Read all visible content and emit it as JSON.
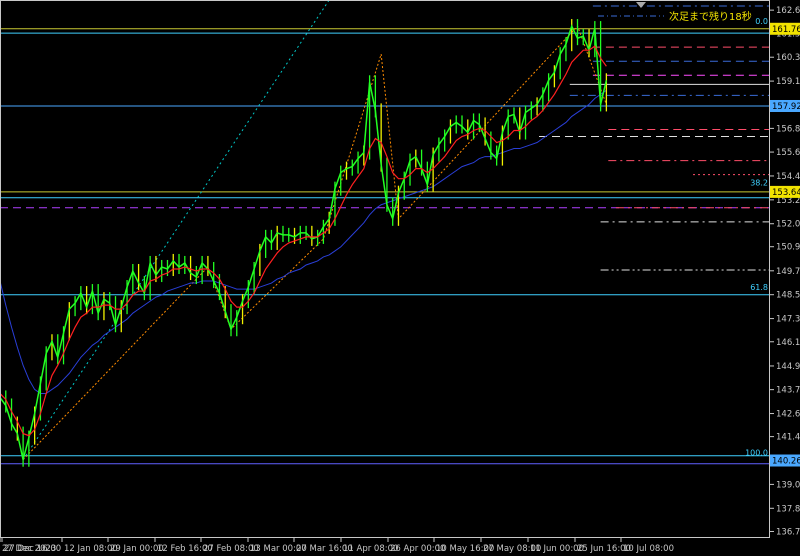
{
  "chart_data": {
    "type": "line",
    "title": "",
    "timer_text": "次足まで残り18秒",
    "ylim": [
      136.4,
      163.2
    ],
    "y_ticks": [
      "162.695",
      "161.540",
      "160.350",
      "159.160",
      "157.920",
      "156.805",
      "155.625",
      "154.435",
      "153.245",
      "152.055",
      "150.910",
      "149.710",
      "148.520",
      "147.330",
      "146.175",
      "144.970",
      "143.790",
      "142.600",
      "141.450",
      "140.260",
      "139.070",
      "137.880",
      "136.725"
    ],
    "x_ticks": [
      "27 Dec 2023",
      "27 Dec 16:00",
      "12 Jan 08:00",
      "29 Jan 00:00",
      "12 Feb 16:00",
      "27 Feb 08:00",
      "13 Mar 00:00",
      "27 Mar 16:00",
      "11 Apr 08:00",
      "26 Apr 00:00",
      "10 May 16:00",
      "27 May 08:00",
      "11 Jun 00:00",
      "25 Jun 16:00",
      "10 Jul 08:00"
    ],
    "price_tags": [
      {
        "label": "161.766",
        "value": 161.766,
        "color": "#f2e300"
      },
      {
        "label": "157.920",
        "value": 157.92,
        "color": "#4aa8ff"
      },
      {
        "label": "153.641",
        "value": 153.641,
        "color": "#f2e300"
      },
      {
        "label": "140.260",
        "value": 140.26,
        "color": "#4aa8ff"
      }
    ],
    "fib_labels": [
      {
        "label": "0.0",
        "value": 161.9
      },
      {
        "label": "38.2",
        "value": 153.85
      },
      {
        "label": "61.8",
        "value": 148.65
      },
      {
        "label": "100.0",
        "value": 140.4
      }
    ],
    "horizontal_lines": [
      {
        "value": 161.766,
        "color": "#c8c832",
        "style": "solid",
        "full": true
      },
      {
        "value": 161.55,
        "color": "#3fd0ff",
        "style": "solid",
        "full": true
      },
      {
        "value": 157.92,
        "color": "#4aa8ff",
        "style": "solid",
        "full": true
      },
      {
        "value": 153.641,
        "color": "#c8c832",
        "style": "solid",
        "full": true
      },
      {
        "value": 153.35,
        "color": "#3fd0ff",
        "style": "solid",
        "full": true
      },
      {
        "value": 152.85,
        "color": "#b040ff",
        "style": "dash",
        "full": true
      },
      {
        "value": 148.52,
        "color": "#3fd0ff",
        "style": "solid",
        "full": true
      },
      {
        "value": 140.5,
        "color": "#3fd0ff",
        "style": "solid",
        "full": true
      },
      {
        "value": 140.1,
        "color": "#6060ff",
        "style": "solid",
        "full": true
      }
    ],
    "right_levels": [
      {
        "value": 162.9,
        "color": "#3a6bd8",
        "style": "dashdot",
        "from": 0.77
      },
      {
        "value": 160.85,
        "color": "#ff4d6a",
        "style": "dash",
        "from": 0.77
      },
      {
        "value": 160.15,
        "color": "#3a6bd8",
        "style": "dash",
        "from": 0.77
      },
      {
        "value": 159.45,
        "color": "#ff4dff",
        "style": "dash",
        "from": 0.77
      },
      {
        "value": 159.0,
        "color": "#e0e0e0",
        "style": "solid",
        "from": 0.74
      },
      {
        "value": 158.45,
        "color": "#3a6bd8",
        "style": "dashdot",
        "from": 0.74
      },
      {
        "value": 156.75,
        "color": "#ff4d6a",
        "style": "dash",
        "from": 0.79
      },
      {
        "value": 156.4,
        "color": "#e0e0e0",
        "style": "dash",
        "from": 0.7
      },
      {
        "value": 155.2,
        "color": "#ff4d6a",
        "style": "dashdot",
        "from": 0.79
      },
      {
        "value": 154.5,
        "color": "#ff4d6a",
        "style": "dot",
        "from": 0.9
      },
      {
        "value": 152.85,
        "color": "#ff4d6a",
        "style": "dashdot",
        "from": 0.8
      },
      {
        "value": 152.15,
        "color": "#e0e0e0",
        "style": "dashdot",
        "from": 0.78
      },
      {
        "value": 149.75,
        "color": "#e0e0e0",
        "style": "dashdotdot",
        "from": 0.78
      }
    ],
    "price_x": [
      0,
      6,
      12,
      18,
      24,
      30,
      36,
      42,
      48,
      54,
      60,
      66,
      72,
      78,
      84,
      90,
      96,
      102,
      108,
      114,
      120,
      126,
      132,
      138,
      144,
      150,
      156,
      162,
      168,
      174,
      180,
      186,
      192,
      198,
      204,
      210,
      216,
      222,
      228,
      234,
      240,
      246,
      252,
      258,
      264,
      270,
      276,
      282,
      288,
      294,
      300,
      306,
      312,
      318,
      324,
      330,
      336,
      342,
      348,
      354,
      360,
      366,
      372,
      378,
      384,
      390,
      396,
      402,
      408,
      414,
      420,
      426,
      432,
      438,
      444,
      450,
      456,
      462,
      468,
      474,
      480,
      486,
      492,
      498,
      504,
      510,
      516,
      522,
      528,
      534,
      540,
      546,
      552,
      558,
      564,
      570,
      576,
      582,
      588,
      594,
      600,
      606,
      612,
      618,
      624,
      630
    ],
    "price_y": [
      143.4,
      143.0,
      142.1,
      141.6,
      140.3,
      141.4,
      142.6,
      144.1,
      145.6,
      146.2,
      145.4,
      146.6,
      147.8,
      148.1,
      148.6,
      147.9,
      148.7,
      147.6,
      148.3,
      148.1,
      147.0,
      147.9,
      148.9,
      149.7,
      149.1,
      148.6,
      150.1,
      149.5,
      149.9,
      149.8,
      150.2,
      149.9,
      150.1,
      149.6,
      149.4,
      150.1,
      149.8,
      149.2,
      148.6,
      147.7,
      146.8,
      147.4,
      148.2,
      148.9,
      149.8,
      150.7,
      151.4,
      151.1,
      151.6,
      151.5,
      151.5,
      151.4,
      151.6,
      151.6,
      151.3,
      151.4,
      151.9,
      152.3,
      153.8,
      154.6,
      154.8,
      154.9,
      155.3,
      155.6,
      159.1,
      157.7,
      155.0,
      153.0,
      152.3,
      153.6,
      154.3,
      155.2,
      155.4,
      154.8,
      154.0,
      155.5,
      156.0,
      156.4,
      156.9,
      157.1,
      156.9,
      156.6,
      157.2,
      157.0,
      156.3,
      155.6,
      155.3,
      156.6,
      157.4,
      157.5,
      156.6,
      157.6,
      157.8,
      158.0,
      158.5,
      159.2,
      159.6,
      160.5,
      161.0,
      161.9,
      161.3,
      161.4,
      160.7,
      161.8,
      158.0,
      159.2
    ],
    "ma_fast_y": [
      143.6,
      143.3,
      142.7,
      142.2,
      141.6,
      141.5,
      141.8,
      142.6,
      143.6,
      144.5,
      145.0,
      145.6,
      146.3,
      146.9,
      147.4,
      147.6,
      147.9,
      147.9,
      148.0,
      148.0,
      147.8,
      147.8,
      148.1,
      148.5,
      148.7,
      148.7,
      149.2,
      149.3,
      149.5,
      149.6,
      149.8,
      149.8,
      149.9,
      149.8,
      149.7,
      149.8,
      149.8,
      149.6,
      149.3,
      148.8,
      148.2,
      147.9,
      147.9,
      148.2,
      148.6,
      149.2,
      149.8,
      150.2,
      150.6,
      150.9,
      151.1,
      151.2,
      151.3,
      151.4,
      151.4,
      151.4,
      151.6,
      151.8,
      152.3,
      152.9,
      153.5,
      154.0,
      154.4,
      154.8,
      155.8,
      156.3,
      156.1,
      155.4,
      154.6,
      154.3,
      154.3,
      154.5,
      154.8,
      154.8,
      154.6,
      154.8,
      155.1,
      155.4,
      155.8,
      156.2,
      156.4,
      156.5,
      156.7,
      156.8,
      156.7,
      156.4,
      156.1,
      156.2,
      156.4,
      156.7,
      156.7,
      156.9,
      157.2,
      157.4,
      157.7,
      158.1,
      158.5,
      159.0,
      159.5,
      160.1,
      160.4,
      160.7,
      160.7,
      160.9,
      160.3,
      159.9
    ],
    "ma_slow_y": [
      149.2,
      148.0,
      146.9,
      145.9,
      145.0,
      144.3,
      143.8,
      143.6,
      143.6,
      143.8,
      144.0,
      144.3,
      144.6,
      145.0,
      145.4,
      145.7,
      146.0,
      146.2,
      146.5,
      146.7,
      146.9,
      147.1,
      147.3,
      147.6,
      147.8,
      148.0,
      148.2,
      148.4,
      148.5,
      148.7,
      148.8,
      148.9,
      149.0,
      149.1,
      149.1,
      149.2,
      149.2,
      149.2,
      149.1,
      149.0,
      148.9,
      148.8,
      148.8,
      148.8,
      148.8,
      148.9,
      149.0,
      149.1,
      149.3,
      149.4,
      149.6,
      149.7,
      149.8,
      150.0,
      150.1,
      150.2,
      150.4,
      150.5,
      150.7,
      150.9,
      151.2,
      151.5,
      151.8,
      152.1,
      152.5,
      152.8,
      153.0,
      153.1,
      153.2,
      153.3,
      153.4,
      153.5,
      153.6,
      153.7,
      153.8,
      153.9,
      154.1,
      154.3,
      154.5,
      154.7,
      154.9,
      155.0,
      155.1,
      155.3,
      155.4,
      155.4,
      155.5,
      155.6,
      155.7,
      155.8,
      155.8,
      155.9,
      156.0,
      156.1,
      156.3,
      156.5,
      156.7,
      156.9,
      157.1,
      157.4,
      157.6,
      157.8,
      158.0,
      158.3,
      158.5,
      158.7
    ],
    "zigzag": [
      [
        24,
        140.3
      ],
      [
        216,
        149.9
      ],
      [
        240,
        146.8
      ],
      [
        336,
        151.3
      ],
      [
        396,
        160.5
      ],
      [
        414,
        152.3
      ],
      [
        600,
        161.9
      ],
      [
        630,
        158.0
      ]
    ],
    "trendline": [
      [
        24,
        140.3
      ],
      [
        342,
        163.2
      ]
    ],
    "colors": {
      "background": "#000000",
      "price": "#22ff22",
      "price_alt": "#f2f200",
      "ma_fast": "#ff2020",
      "ma_slow": "#2a3fd8",
      "zigzag": "#ff8c00",
      "trendline": "#00c8c8",
      "axis": "#c8c8c8"
    }
  }
}
